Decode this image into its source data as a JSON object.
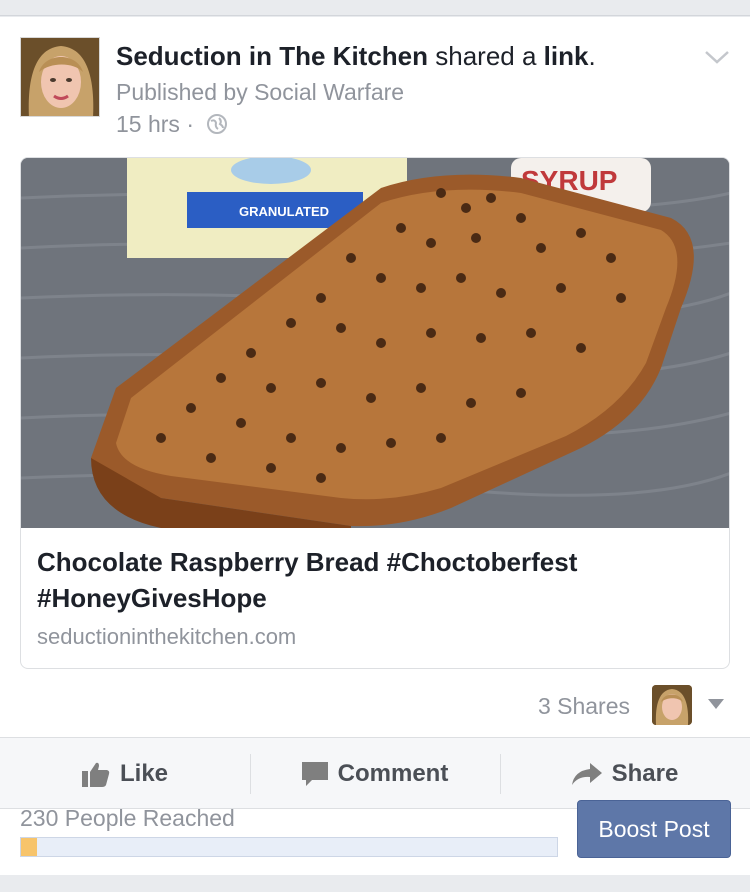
{
  "post": {
    "page_name": "Seduction in The Kitchen",
    "shared_verb": "shared a",
    "link_word": "link",
    "period": ".",
    "published_by": "Published by Social Warfare",
    "time": "15 hrs",
    "time_separator": "·",
    "audience_icon": "globe-icon",
    "menu_icon": "chevron-down-icon"
  },
  "link": {
    "title": "Chocolate Raspberry Bread #Choctoberfest #HoneyGivesHope",
    "domain": "seductioninthekitchen.com",
    "image_text": {
      "bag_label": "GRANULATED",
      "jar_label": "SYRUP"
    }
  },
  "engagement": {
    "shares": "3 Shares"
  },
  "actions": {
    "like": "Like",
    "comment": "Comment",
    "share": "Share"
  },
  "insights": {
    "reached": "230 People Reached",
    "reach_fraction": 0.03,
    "boost_label": "Boost Post"
  },
  "colors": {
    "boost_button": "#5e77a8",
    "reach_fill": "#f7c46b",
    "link_blue": "#1d2129"
  }
}
